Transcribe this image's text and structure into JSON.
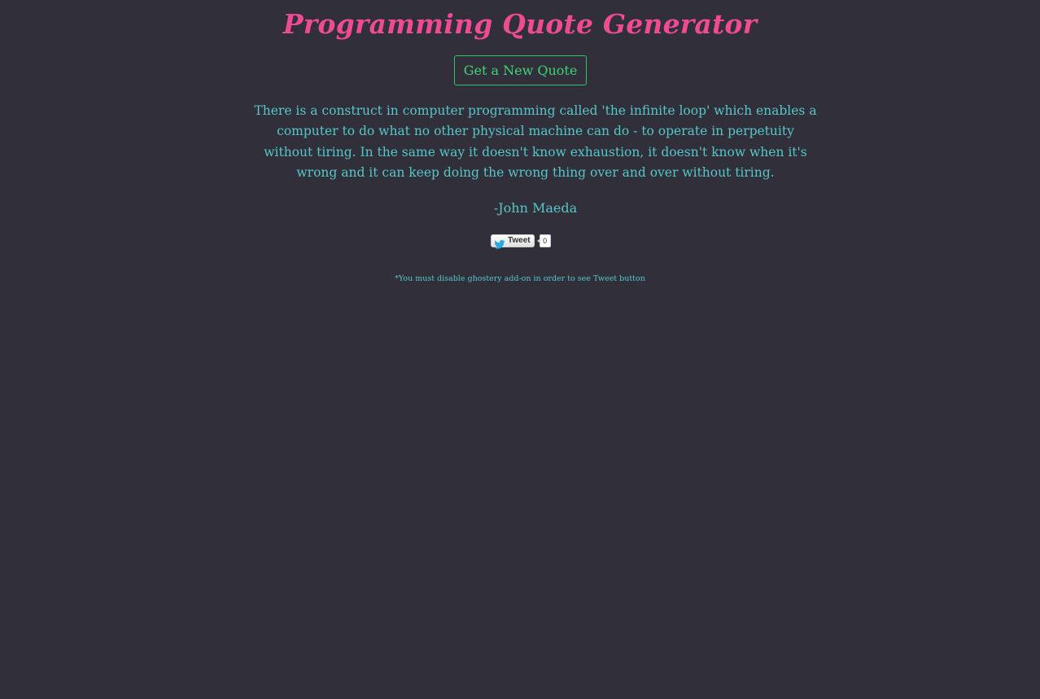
{
  "header": {
    "title": "Programming Quote Generator"
  },
  "controls": {
    "new_quote_label": "Get a New Quote"
  },
  "quote": {
    "text": "There is a construct in computer programming called 'the infinite loop' which enables a computer to do what no other physical machine can do - to operate in perpetuity without tiring. In the same way it doesn't know exhaustion, it doesn't know when it's wrong and it can keep doing the wrong thing over and over without tiring.",
    "author": "-John Maeda"
  },
  "tweet": {
    "label": "Tweet",
    "count": "0",
    "icon": "twitter-bird-icon"
  },
  "footer": {
    "note": "*You must disable ghostery add-on in order to see Tweet button"
  },
  "colors": {
    "background": "#302f3a",
    "title": "#ee4b92",
    "button": "#3fd47a",
    "text": "#56c7c9"
  }
}
